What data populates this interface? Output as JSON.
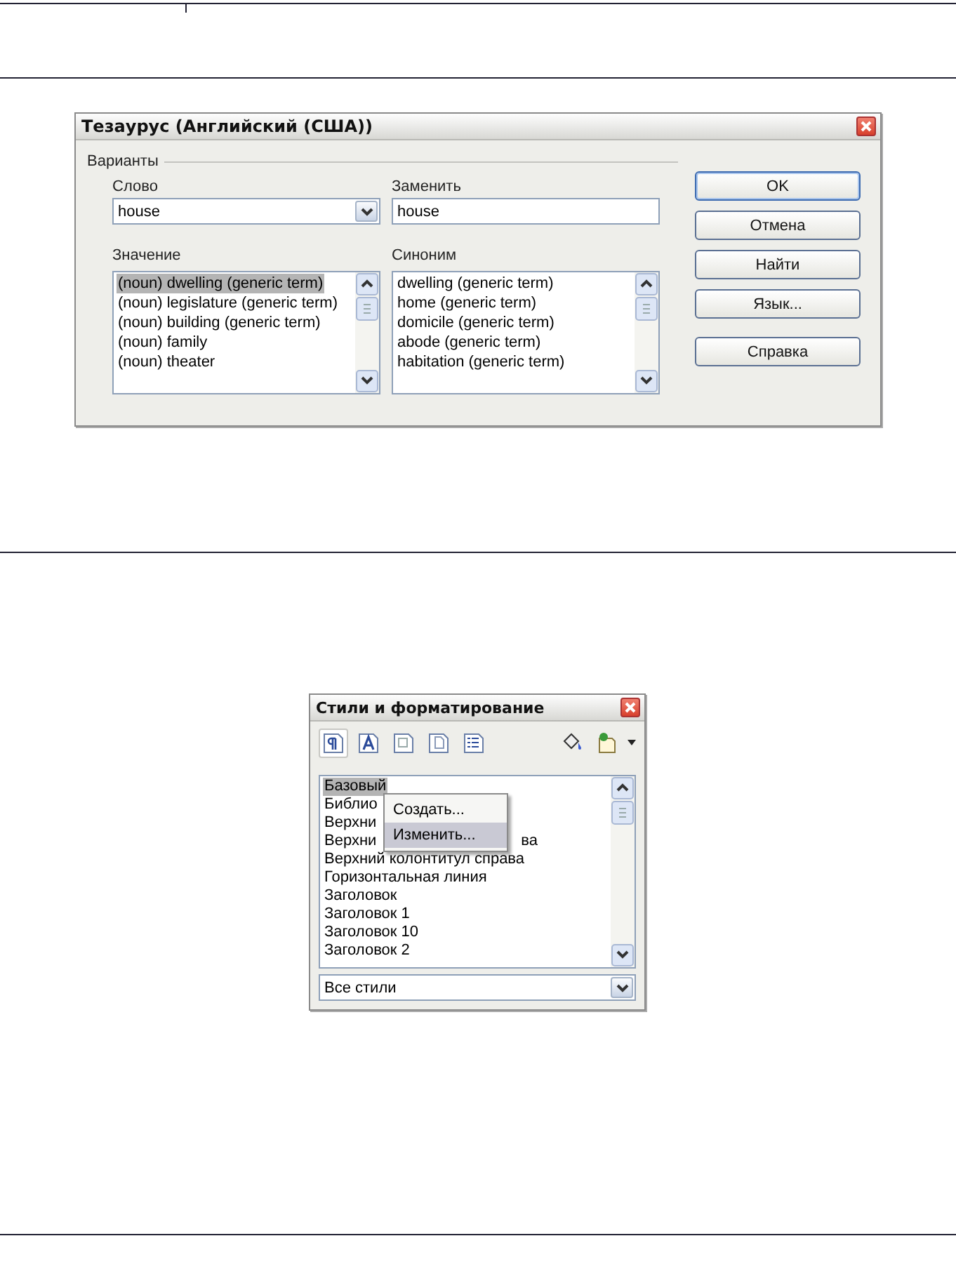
{
  "thesaurus": {
    "title": "Тезаурус (Английский (США))",
    "group_label": "Варианты",
    "word": {
      "label": "Слово",
      "value": "house"
    },
    "replace": {
      "label": "Заменить",
      "value": "house"
    },
    "meanings": {
      "label": "Значение",
      "items": [
        {
          "text": "(noun) dwelling (generic term)",
          "selected": true
        },
        {
          "text": "(noun) legislature (generic term)",
          "selected": false
        },
        {
          "text": "(noun) building (generic term)",
          "selected": false
        },
        {
          "text": "(noun) family",
          "selected": false
        },
        {
          "text": "(noun) theater",
          "selected": false
        }
      ]
    },
    "synonyms": {
      "label": "Синоним",
      "items": [
        {
          "text": "dwelling (generic term)",
          "selected": false
        },
        {
          "text": "home (generic term)",
          "selected": false
        },
        {
          "text": "domicile (generic term)",
          "selected": false
        },
        {
          "text": "abode (generic term)",
          "selected": false
        },
        {
          "text": "habitation (generic term)",
          "selected": false
        }
      ]
    },
    "buttons": [
      {
        "label": "OK",
        "kind": "default"
      },
      {
        "label": "Отмена",
        "kind": "normal"
      },
      {
        "label": "Найти",
        "kind": "normal"
      },
      {
        "label": "Язык...",
        "kind": "normal"
      },
      {
        "label": "Справка",
        "kind": "separated"
      }
    ]
  },
  "styles_window": {
    "title": "Стили и форматирование",
    "families": [
      {
        "kind": "paragraph",
        "selected": true
      },
      {
        "kind": "character",
        "selected": false
      },
      {
        "kind": "frame",
        "selected": false
      },
      {
        "kind": "page",
        "selected": false
      },
      {
        "kind": "list",
        "selected": false
      }
    ],
    "actions": [
      {
        "kind": "fill"
      },
      {
        "kind": "new"
      }
    ],
    "items": [
      {
        "text": "Базовый",
        "selected": true
      },
      {
        "text": "Библио",
        "selected": false
      },
      {
        "text": "Верхни",
        "selected": false
      },
      {
        "text": "Верхни",
        "tail": "ва",
        "selected": false
      },
      {
        "text": "Верхний колонтитул справа",
        "selected": false
      },
      {
        "text": "Горизонтальная линия",
        "selected": false
      },
      {
        "text": "Заголовок",
        "selected": false
      },
      {
        "text": "Заголовок 1",
        "selected": false
      },
      {
        "text": "Заголовок 10",
        "selected": false
      },
      {
        "text": "Заголовок 2",
        "selected": false
      }
    ],
    "context_menu": [
      {
        "label": "Создать...",
        "selected": false
      },
      {
        "label": "Изменить...",
        "selected": true
      }
    ],
    "filter": {
      "value": "Все стили"
    }
  }
}
